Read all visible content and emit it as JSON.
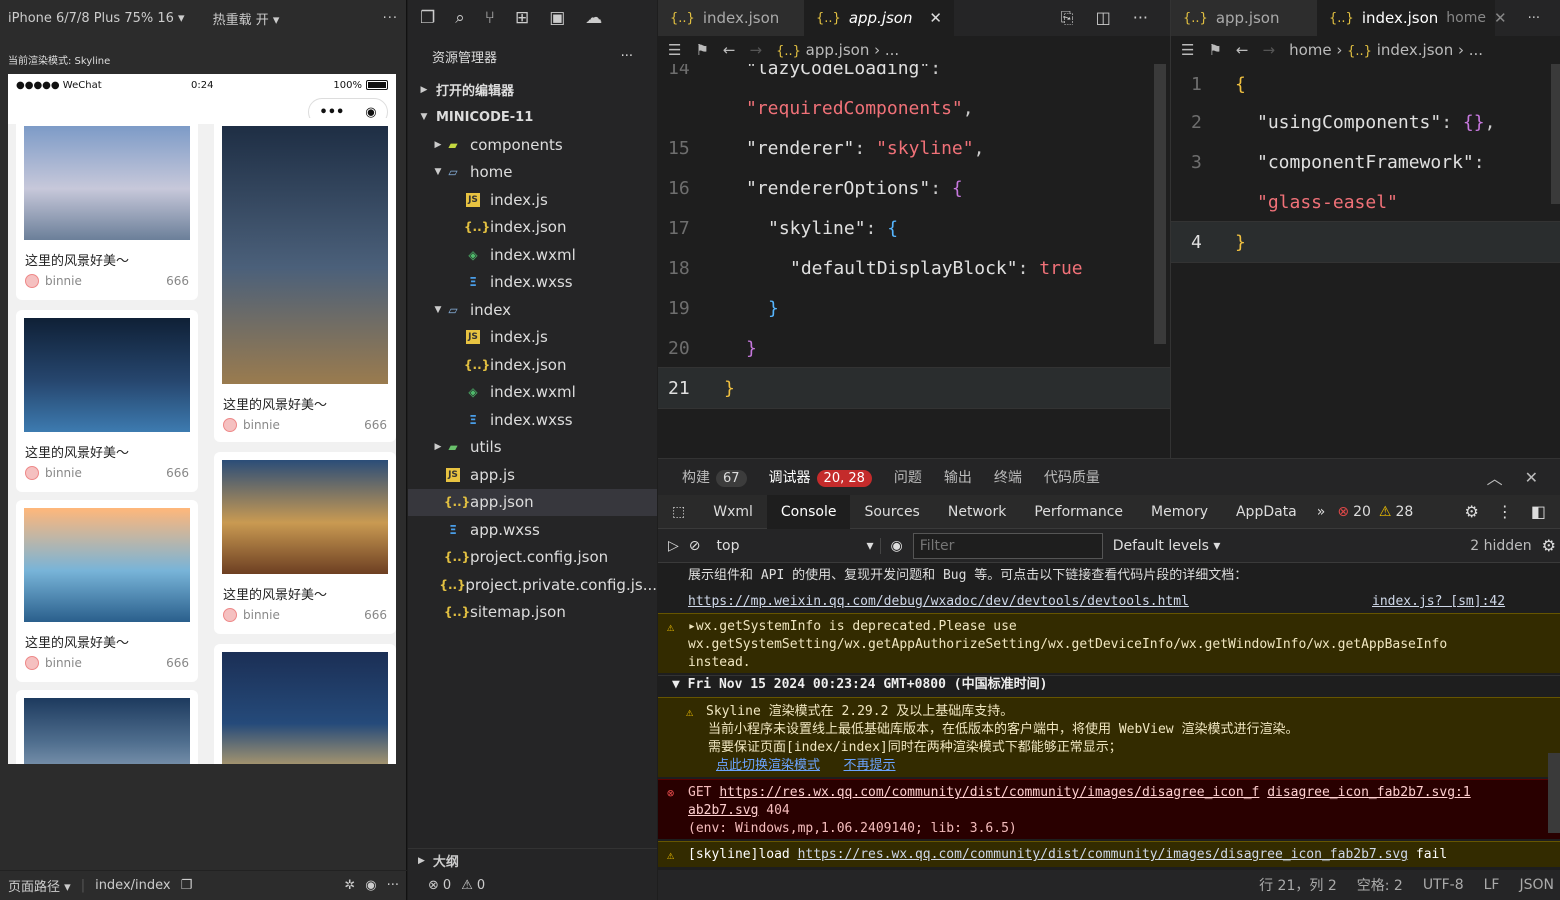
{
  "simulator": {
    "device": "iPhone 6/7/8 Plus 75% 16",
    "hot_reload": "热重载 开",
    "more": "···",
    "render_mode": "当前渲染模式: Skyline",
    "status": {
      "carrier": "●●●●● WeChat",
      "time": "0:24",
      "battery": "100%"
    },
    "capsule_more": "•••",
    "cards": [
      {
        "title": "这里的风景好美～",
        "author": "binnie",
        "likes": "666",
        "colors": [
          "#7d9bc7",
          "#c7c8da",
          "#6b7f99"
        ]
      },
      {
        "title": "这里的风景好美～",
        "author": "binnie",
        "likes": "666",
        "colors": [
          "#0f2036",
          "#26466e",
          "#3d7bb0"
        ]
      },
      {
        "title": "这里的风景好美～",
        "author": "binnie",
        "likes": "666",
        "colors": [
          "#ffb77a",
          "#78b4d8",
          "#2a5f8c"
        ]
      },
      {
        "title": "",
        "author": "",
        "likes": "",
        "colors": [
          "#1d3a5e",
          "#4f6e8e",
          "#8aa0b8"
        ]
      },
      {
        "title": "这里的风景好美～",
        "author": "binnie",
        "likes": "666",
        "colors": [
          "#1e2e44",
          "#4b607a",
          "#9a7b4e"
        ]
      },
      {
        "title": "这里的风景好美～",
        "author": "binnie",
        "likes": "666",
        "colors": [
          "#2b4d78",
          "#c99a52",
          "#6d3f22"
        ]
      },
      {
        "title": "",
        "author": "",
        "likes": "",
        "colors": [
          "#1b2f55",
          "#254a7a",
          "#d9b36a"
        ]
      }
    ],
    "bottom": {
      "path_label": "页面路径",
      "path": "index/index"
    }
  },
  "explorer": {
    "title": "资源管理器",
    "more": "···",
    "open_editors": "打开的编辑器",
    "project": "MINICODE-11",
    "tree": [
      {
        "label": "components",
        "type": "folder",
        "depth": 1,
        "arrow": "▶",
        "icon": "▰",
        "color": "#c5d940"
      },
      {
        "label": "home",
        "type": "folder",
        "depth": 1,
        "arrow": "▼",
        "icon": "▱",
        "color": "#8ab4e0"
      },
      {
        "label": "index.js",
        "type": "js",
        "depth": 2,
        "arrow": "",
        "icon": "JS",
        "color": "#e8c341"
      },
      {
        "label": "index.json",
        "type": "json",
        "depth": 2,
        "arrow": "",
        "icon": "{..}",
        "color": "#e2c041"
      },
      {
        "label": "index.wxml",
        "type": "wxml",
        "depth": 2,
        "arrow": "",
        "icon": "◈",
        "color": "#4fb96b"
      },
      {
        "label": "index.wxss",
        "type": "wxss",
        "depth": 2,
        "arrow": "",
        "icon": "Ξ",
        "color": "#4a9ee8"
      },
      {
        "label": "index",
        "type": "folder",
        "depth": 1,
        "arrow": "▼",
        "icon": "▱",
        "color": "#8ab4e0"
      },
      {
        "label": "index.js",
        "type": "js",
        "depth": 2,
        "arrow": "",
        "icon": "JS",
        "color": "#e8c341"
      },
      {
        "label": "index.json",
        "type": "json",
        "depth": 2,
        "arrow": "",
        "icon": "{..}",
        "color": "#e2c041"
      },
      {
        "label": "index.wxml",
        "type": "wxml",
        "depth": 2,
        "arrow": "",
        "icon": "◈",
        "color": "#4fb96b"
      },
      {
        "label": "index.wxss",
        "type": "wxss",
        "depth": 2,
        "arrow": "",
        "icon": "Ξ",
        "color": "#4a9ee8"
      },
      {
        "label": "utils",
        "type": "folder",
        "depth": 1,
        "arrow": "▶",
        "icon": "▰",
        "color": "#69c16b"
      },
      {
        "label": "app.js",
        "type": "js",
        "depth": 1,
        "arrow": "",
        "icon": "JS",
        "color": "#e8c341"
      },
      {
        "label": "app.json",
        "type": "json",
        "depth": 1,
        "arrow": "",
        "icon": "{..}",
        "color": "#e2c041",
        "selected": true
      },
      {
        "label": "app.wxss",
        "type": "wxss",
        "depth": 1,
        "arrow": "",
        "icon": "Ξ",
        "color": "#4a9ee8"
      },
      {
        "label": "project.config.json",
        "type": "json",
        "depth": 1,
        "arrow": "",
        "icon": "{..}",
        "color": "#e2c041"
      },
      {
        "label": "project.private.config.js...",
        "type": "json",
        "depth": 1,
        "arrow": "",
        "icon": "{..}",
        "color": "#e2c041"
      },
      {
        "label": "sitemap.json",
        "type": "json",
        "depth": 1,
        "arrow": "",
        "icon": "{..}",
        "color": "#e2c041"
      }
    ],
    "outline": "大纲",
    "errors": "0",
    "warnings": "0"
  },
  "editor_left": {
    "tabs": [
      {
        "label": "index.json",
        "active": false
      },
      {
        "label": "app.json",
        "active": true
      }
    ],
    "breadcrumb": "app.json",
    "breadcrumb_more": "...",
    "lines": [
      {
        "n": "14",
        "html": "\"lazyCodeLoading\":"
      },
      {
        "n": "",
        "html": "\"requiredComponents\","
      },
      {
        "n": "15",
        "html": "\"renderer\": \"skyline\","
      },
      {
        "n": "16",
        "html": "\"rendererOptions\": {"
      },
      {
        "n": "17",
        "html": "\"skyline\": {"
      },
      {
        "n": "18",
        "html": "\"defaultDisplayBlock\": true"
      },
      {
        "n": "19",
        "html": "}"
      },
      {
        "n": "20",
        "html": "}"
      },
      {
        "n": "21",
        "html": "}"
      }
    ]
  },
  "editor_right": {
    "tabs": [
      {
        "label": "app.json",
        "active": false
      },
      {
        "label": "index.json",
        "suffix": "home",
        "active": true
      }
    ],
    "breadcrumb": [
      "home",
      "index.json",
      "..."
    ],
    "lines": [
      {
        "n": "1",
        "html": "{"
      },
      {
        "n": "2",
        "html": "\"usingComponents\": {},"
      },
      {
        "n": "3",
        "html": "\"componentFramework\":"
      },
      {
        "n": "",
        "html": "\"glass-easel\""
      },
      {
        "n": "4",
        "html": "}"
      }
    ]
  },
  "debug": {
    "tabs": [
      {
        "label": "构建",
        "badge": "67"
      },
      {
        "label": "调试器",
        "badge": "20, 28"
      },
      {
        "label": "问题",
        "badge": ""
      },
      {
        "label": "输出",
        "badge": ""
      },
      {
        "label": "终端",
        "badge": ""
      },
      {
        "label": "代码质量",
        "badge": ""
      }
    ],
    "devtools_tabs": [
      "Wxml",
      "Console",
      "Sources",
      "Network",
      "Performance",
      "Memory",
      "AppData"
    ],
    "overflow": "»",
    "error_count": "20",
    "warning_count": "28",
    "context": "top",
    "filter_placeholder": "Filter",
    "levels": "Default levels",
    "hidden": "2 hidden",
    "messages": {
      "m0_line1": "展示组件和 API 的使用、复现开发问题和 Bug 等。可点击以下链接查看代码片段的详细文档：",
      "m0_link": "https://mp.weixin.qq.com/debug/wxadoc/dev/devtools/devtools.html",
      "m0_src": "index.js? [sm]:42",
      "m1_line1": "wx.getSystemInfo is deprecated.Please use",
      "m1_line2": "wx.getSystemSetting/wx.getAppAuthorizeSetting/wx.getDeviceInfo/wx.getWindowInfo/wx.getAppBaseInfo",
      "m1_line3": "instead.",
      "group": "Fri Nov 15 2024 00:23:24 GMT+0800 (中国标准时间)",
      "m2_line1": "Skyline 渲染模式在 2.29.2 及以上基础库支持。",
      "m2_line2": "当前小程序未设置线上最低基础库版本，在低版本的客户端中，将使用 WebView 渲染模式进行渲染。",
      "m2_line3": "需要保证页面[index/index]同时在两种渲染模式下都能够正常显示；",
      "m2_link1": "点此切换渲染模式",
      "m2_link2": "不再提示",
      "m3_get": "GET",
      "m3_url": "https://res.wx.qq.com/community/dist/community/images/disagree_icon_f",
      "m3_src": "disagree_icon_fab2b7.svg:1",
      "m3_url2": "ab2b7.svg",
      "m3_code": "404",
      "m3_env": "(env: Windows,mp,1.06.2409140; lib: 3.6.5)",
      "m4_prefix": "[skyline]load",
      "m4_url": "https://res.wx.qq.com/community/dist/community/images/disagree_icon_fab2b7.svg",
      "m4_suffix": "fail"
    }
  },
  "statusbar": {
    "position": "行 21，列 2",
    "spaces": "空格: 2",
    "encoding": "UTF-8",
    "eol": "LF",
    "lang": "JSON"
  }
}
